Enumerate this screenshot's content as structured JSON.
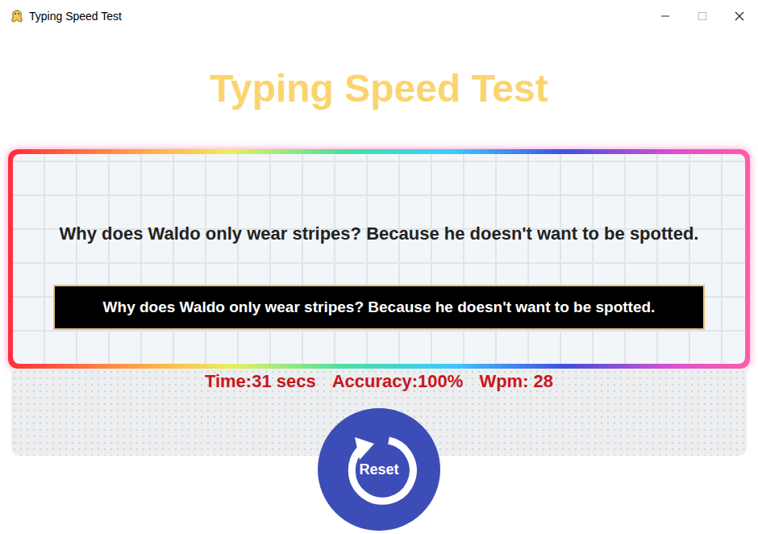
{
  "window": {
    "title": "Typing Speed Test"
  },
  "heading": "Typing Speed Test",
  "prompt": "Why does Waldo only wear stripes? Because he doesn't want to be spotted.",
  "input": {
    "value": "Why does Waldo only wear stripes? Because he doesn't want to be spotted."
  },
  "results": [
    "Time:31 secs",
    "Accuracy:100%",
    "Wpm: 28"
  ],
  "reset_button": {
    "label": "Reset"
  }
}
